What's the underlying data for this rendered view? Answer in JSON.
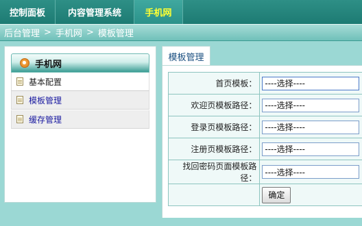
{
  "topnav": {
    "items": [
      {
        "label": "控制面板"
      },
      {
        "label": "内容管理系统"
      },
      {
        "label": "手机网"
      }
    ],
    "active_index": 2
  },
  "breadcrumb": {
    "items": [
      "后台管理",
      "手机网",
      "模板管理"
    ],
    "separator": ">"
  },
  "sidebar": {
    "title": "手机网",
    "items": [
      {
        "label": "基本配置"
      },
      {
        "label": "模板管理"
      },
      {
        "label": "缓存管理"
      }
    ]
  },
  "main": {
    "tab_label": "模板管理",
    "rows": [
      {
        "label": "首页模板：",
        "value": "----选择----"
      },
      {
        "label": "欢迎页模板路径：",
        "value": "----选择----"
      },
      {
        "label": "登录页模板路径：",
        "value": "----选择----"
      },
      {
        "label": "注册页模板路径：",
        "value": "----选择----"
      },
      {
        "label": "找回密码页面模板路径：",
        "value": "----选择----"
      }
    ],
    "confirm_label": "确定"
  },
  "colors": {
    "nav_bg": "#1d7b73",
    "active_nav_text": "#ffff33",
    "page_bg": "#9bd8d4",
    "link_text": "#1a1aa0"
  },
  "icons": {
    "sidebar_header": "orange-disc-icon",
    "menu_item": "document-icon"
  }
}
